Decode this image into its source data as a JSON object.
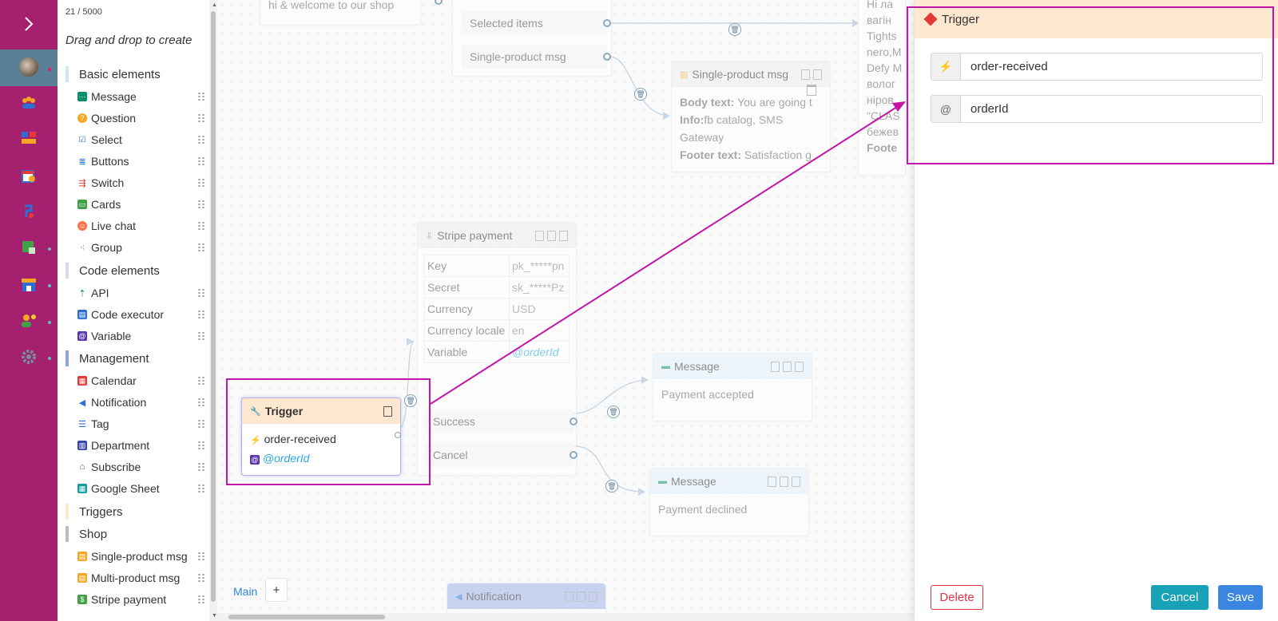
{
  "palette": {
    "counter": "21 / 5000",
    "hint": "Drag and drop to create",
    "sections": [
      {
        "label": "Basic elements",
        "color": "#cfe6f5"
      },
      {
        "label": "Code elements",
        "color": "#ddd6f0"
      },
      {
        "label": "Management",
        "color": "#8fa6d8"
      },
      {
        "label": "Triggers",
        "color": "#fde8cf"
      },
      {
        "label": "Shop",
        "color": "#bdbdbd"
      }
    ],
    "basic_items": [
      "Message",
      "Question",
      "Select",
      "Buttons",
      "Switch",
      "Cards",
      "Live chat",
      "Group"
    ],
    "code_items": [
      "API",
      "Code executor",
      "Variable"
    ],
    "management_items": [
      "Calendar",
      "Notification",
      "Tag",
      "Department",
      "Subscribe",
      "Google Sheet"
    ],
    "shop_items": [
      "Single-product msg",
      "Multi-product msg",
      "Stripe payment"
    ]
  },
  "canvas": {
    "top_node_text": "hi & welcome to our shop",
    "outputs": [
      "Selected items",
      "Single-product msg"
    ],
    "catalog_fragment": [
      "Hi ла",
      "вагін",
      "Tights",
      "nero,M",
      "Defy M",
      "волог",
      "ніров",
      "\"CLAS",
      "бежев",
      "Foote"
    ],
    "single_product": {
      "title": "Single-product msg",
      "body_label": "Body text:",
      "body_value": "You are going t",
      "info_label": "Info:",
      "info_value": "fb catalog, SMS Gateway",
      "footer_label": "Footer text:",
      "footer_value": "Satisfaction g"
    },
    "stripe": {
      "title": "Stripe payment",
      "rows": [
        {
          "key": "Key",
          "value": "pk_*****pn"
        },
        {
          "key": "Secret",
          "value": "sk_*****Pz"
        },
        {
          "key": "Currency",
          "value": "USD"
        },
        {
          "key": "Currency locale",
          "value": "en"
        },
        {
          "key": "Variable",
          "value": "@orderId"
        }
      ],
      "success": "Success",
      "cancel": "Cancel"
    },
    "trigger": {
      "title": "Trigger",
      "event": "order-received",
      "variable": "@orderId"
    },
    "message_accepted": {
      "title": "Message",
      "text": "Payment accepted"
    },
    "message_declined": {
      "title": "Message",
      "text": "Payment declined"
    },
    "notification": {
      "title": "Notification"
    },
    "tab_main": "Main",
    "tab_add": "+"
  },
  "drawer": {
    "title": "Trigger",
    "event_prefix": "⚡",
    "event_value": "order-received",
    "var_prefix": "@",
    "var_value": "orderId",
    "delete_label": "Delete",
    "cancel_label": "Cancel",
    "save_label": "Save"
  },
  "colors": {
    "rail": "#a5206f",
    "highlight": "#c315a8",
    "trigger_header": "#fde8cf",
    "cancel_button": "#17a2b8",
    "save_button": "#3a86e0",
    "delete_border": "#dc3545"
  }
}
